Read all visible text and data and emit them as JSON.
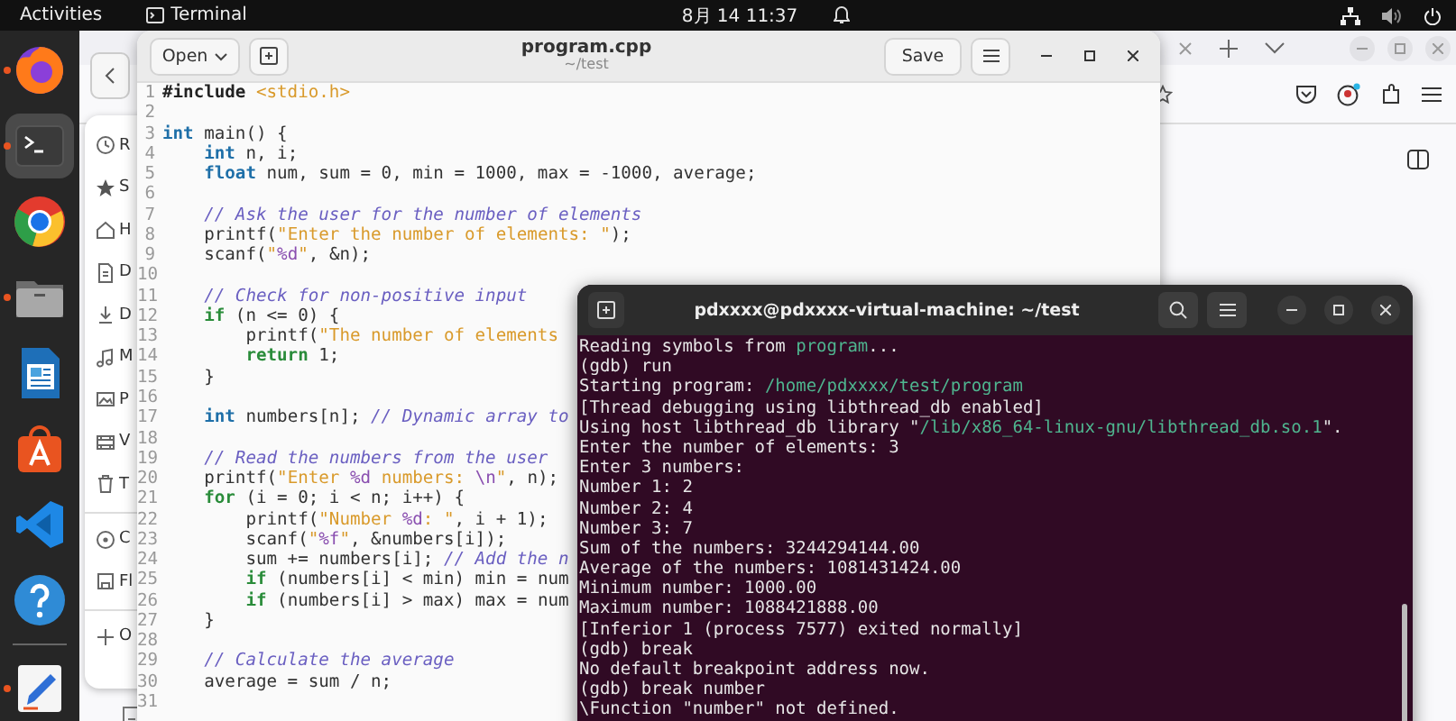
{
  "top_bar": {
    "activities": "Activities",
    "app_name": "Terminal",
    "clock": "8月 14 11:37"
  },
  "dock": [
    {
      "running": true,
      "selected": false
    },
    {
      "running": true,
      "selected": true
    },
    {
      "running": false,
      "selected": false
    },
    {
      "running": true,
      "selected": false
    },
    {
      "running": false,
      "selected": false
    },
    {
      "running": false,
      "selected": false
    },
    {
      "running": false,
      "selected": false
    },
    {
      "running": false,
      "selected": false
    },
    {
      "running": true,
      "selected": false
    }
  ],
  "back_window": {
    "sidebar": {
      "sections": [
        {
          "items": [
            {
              "label": "R"
            },
            {
              "label": "S"
            },
            {
              "label": "H"
            },
            {
              "label": "D"
            },
            {
              "label": "D"
            },
            {
              "label": "M"
            },
            {
              "label": "P"
            },
            {
              "label": "V"
            },
            {
              "label": "T"
            }
          ]
        },
        {
          "items": [
            {
              "label": "C"
            },
            {
              "label": "Fl"
            }
          ]
        },
        {
          "items": [
            {
              "label": "O"
            }
          ]
        }
      ]
    }
  },
  "editor": {
    "open_button": "Open",
    "title": "program.cpp",
    "subtitle": "~/test",
    "save_button": "Save",
    "lines": [
      {
        "number": "1",
        "tokens": [
          {
            "kind": "pre",
            "text": "#include "
          },
          {
            "kind": "str",
            "text": "<stdio.h>"
          }
        ]
      },
      {
        "number": "2"
      },
      {
        "number": "3",
        "tokens": [
          {
            "kind": "type",
            "text": "int"
          },
          {
            "kind": "plain",
            "text": " main() {"
          }
        ]
      },
      {
        "number": "4",
        "tokens": [
          {
            "kind": "type",
            "text": "    int"
          },
          {
            "kind": "plain",
            "text": " n, i;"
          }
        ]
      },
      {
        "number": "5",
        "tokens": [
          {
            "kind": "type",
            "text": "    float"
          },
          {
            "kind": "plain",
            "text": " num, sum = 0, min = 1000, max = -1000, average;"
          }
        ]
      },
      {
        "number": "6"
      },
      {
        "number": "7",
        "tokens": [
          {
            "kind": "cmt",
            "text": "    // Ask the user for the number of elements"
          }
        ]
      },
      {
        "number": "8",
        "tokens": [
          {
            "kind": "plain",
            "text": "    printf("
          },
          {
            "kind": "str",
            "text": "\"Enter the number of elements: \""
          },
          {
            "kind": "plain",
            "text": ");"
          }
        ]
      },
      {
        "number": "9",
        "tokens": [
          {
            "kind": "plain",
            "text": "    scanf("
          },
          {
            "kind": "str",
            "text": "\""
          },
          {
            "kind": "esc",
            "text": "%d"
          },
          {
            "kind": "str",
            "text": "\""
          },
          {
            "kind": "plain",
            "text": ", &n);"
          }
        ]
      },
      {
        "number": "10"
      },
      {
        "number": "11",
        "tokens": [
          {
            "kind": "cmt",
            "text": "    // Check for non-positive input"
          }
        ]
      },
      {
        "number": "12",
        "tokens": [
          {
            "kind": "kw",
            "text": "    if"
          },
          {
            "kind": "plain",
            "text": " (n <= 0) {"
          }
        ]
      },
      {
        "number": "13",
        "tokens": [
          {
            "kind": "plain",
            "text": "        printf("
          },
          {
            "kind": "str",
            "text": "\"The number of elements"
          }
        ]
      },
      {
        "number": "14",
        "tokens": [
          {
            "kind": "kw",
            "text": "        return"
          },
          {
            "kind": "plain",
            "text": " 1;"
          }
        ]
      },
      {
        "number": "15",
        "tokens": [
          {
            "kind": "plain",
            "text": "    }"
          }
        ]
      },
      {
        "number": "16"
      },
      {
        "number": "17",
        "tokens": [
          {
            "kind": "type",
            "text": "    int"
          },
          {
            "kind": "plain",
            "text": " numbers[n]; "
          },
          {
            "kind": "cmt",
            "text": "// Dynamic array to"
          }
        ]
      },
      {
        "number": "18"
      },
      {
        "number": "19",
        "tokens": [
          {
            "kind": "cmt",
            "text": "    // Read the numbers from the user"
          }
        ]
      },
      {
        "number": "20",
        "tokens": [
          {
            "kind": "plain",
            "text": "    printf("
          },
          {
            "kind": "str",
            "text": "\"Enter "
          },
          {
            "kind": "esc",
            "text": "%d"
          },
          {
            "kind": "str",
            "text": " numbers: "
          },
          {
            "kind": "esc",
            "text": "\\n"
          },
          {
            "kind": "str",
            "text": "\""
          },
          {
            "kind": "plain",
            "text": ", n);"
          }
        ]
      },
      {
        "number": "21",
        "tokens": [
          {
            "kind": "kw",
            "text": "    for"
          },
          {
            "kind": "plain",
            "text": " (i = 0; i < n; i++) {"
          }
        ]
      },
      {
        "number": "22",
        "tokens": [
          {
            "kind": "plain",
            "text": "        printf("
          },
          {
            "kind": "str",
            "text": "\"Number "
          },
          {
            "kind": "esc",
            "text": "%d"
          },
          {
            "kind": "str",
            "text": ": \""
          },
          {
            "kind": "plain",
            "text": ", i + 1);"
          }
        ]
      },
      {
        "number": "23",
        "tokens": [
          {
            "kind": "plain",
            "text": "        scanf("
          },
          {
            "kind": "str",
            "text": "\""
          },
          {
            "kind": "esc",
            "text": "%f"
          },
          {
            "kind": "str",
            "text": "\""
          },
          {
            "kind": "plain",
            "text": ", &numbers[i]);"
          }
        ]
      },
      {
        "number": "24",
        "tokens": [
          {
            "kind": "plain",
            "text": "        sum += numbers[i]; "
          },
          {
            "kind": "cmt",
            "text": "// Add the n"
          }
        ]
      },
      {
        "number": "25",
        "tokens": [
          {
            "kind": "kw",
            "text": "        if"
          },
          {
            "kind": "plain",
            "text": " (numbers[i] < min) min = num"
          }
        ]
      },
      {
        "number": "26",
        "tokens": [
          {
            "kind": "kw",
            "text": "        if"
          },
          {
            "kind": "plain",
            "text": " (numbers[i] > max) max = num"
          }
        ]
      },
      {
        "number": "27",
        "tokens": [
          {
            "kind": "plain",
            "text": "    }"
          }
        ]
      },
      {
        "number": "28"
      },
      {
        "number": "29",
        "tokens": [
          {
            "kind": "cmt",
            "text": "    // Calculate the average"
          }
        ]
      },
      {
        "number": "30",
        "tokens": [
          {
            "kind": "plain",
            "text": "    average = sum / n;"
          }
        ]
      },
      {
        "number": "31"
      }
    ]
  },
  "terminal": {
    "title": "pdxxxx@pdxxxx-virtual-machine: ~/test",
    "lines": [
      [
        {
          "kind": "plain",
          "text": "Reading symbols from "
        },
        {
          "kind": "path",
          "text": "program"
        },
        {
          "kind": "plain",
          "text": "..."
        }
      ],
      [
        {
          "kind": "plain",
          "text": "(gdb) run"
        }
      ],
      [
        {
          "kind": "plain",
          "text": "Starting program: "
        },
        {
          "kind": "path",
          "text": "/home/pdxxxx/test/program"
        }
      ],
      [
        {
          "kind": "plain",
          "text": "[Thread debugging using libthread_db enabled]"
        }
      ],
      [
        {
          "kind": "plain",
          "text": "Using host libthread_db library \""
        },
        {
          "kind": "path",
          "text": "/lib/x86_64-linux-gnu/libthread_db.so.1"
        },
        {
          "kind": "plain",
          "text": "\"."
        }
      ],
      [
        {
          "kind": "plain",
          "text": "Enter the number of elements: 3"
        }
      ],
      [
        {
          "kind": "plain",
          "text": "Enter 3 numbers:"
        }
      ],
      [
        {
          "kind": "plain",
          "text": "Number 1: 2"
        }
      ],
      [
        {
          "kind": "plain",
          "text": "Number 2: 4"
        }
      ],
      [
        {
          "kind": "plain",
          "text": "Number 3: 7"
        }
      ],
      [
        {
          "kind": "plain",
          "text": "Sum of the numbers: 3244294144.00"
        }
      ],
      [
        {
          "kind": "plain",
          "text": "Average of the numbers: 1081431424.00"
        }
      ],
      [
        {
          "kind": "plain",
          "text": "Minimum number: 1000.00"
        }
      ],
      [
        {
          "kind": "plain",
          "text": "Maximum number: 1088421888.00"
        }
      ],
      [
        {
          "kind": "plain",
          "text": "[Inferior 1 (process 7577) exited normally]"
        }
      ],
      [
        {
          "kind": "plain",
          "text": "(gdb) break"
        }
      ],
      [
        {
          "kind": "plain",
          "text": "No default breakpoint address now."
        }
      ],
      [
        {
          "kind": "plain",
          "text": "(gdb) break number"
        }
      ],
      [
        {
          "kind": "plain",
          "text": "\\Function \"number\" not defined."
        }
      ]
    ]
  }
}
